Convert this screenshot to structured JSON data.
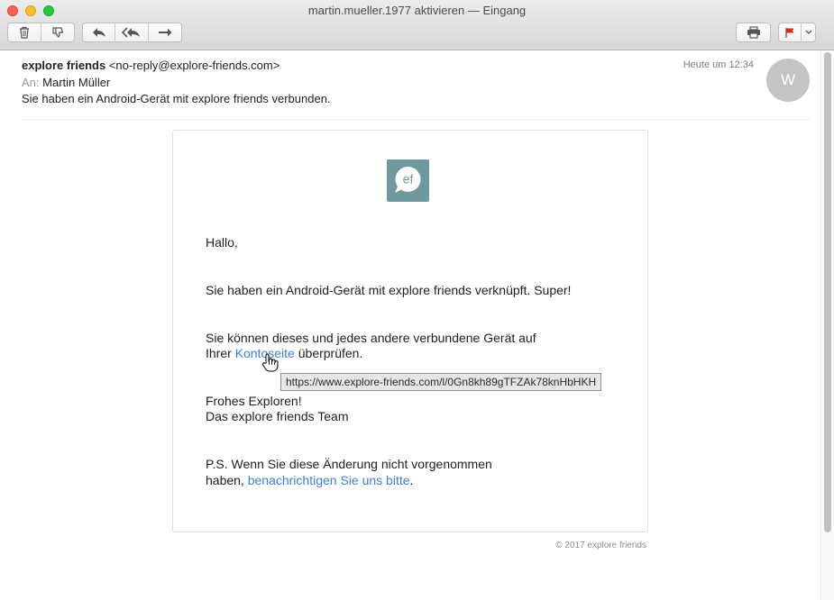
{
  "window": {
    "title": "martin.mueller.1977 aktivieren — Eingang"
  },
  "toolbar": {
    "icons": [
      "trash-icon",
      "junk-thumbs-down-icon",
      "reply-icon",
      "reply-all-icon",
      "forward-icon",
      "print-icon",
      "flag-icon",
      "chevron-down-icon"
    ],
    "flag_color": "#e8271f"
  },
  "email": {
    "from_name": "explore friends",
    "from_address": "<no-reply@explore-friends.com>",
    "to_label": "An:",
    "to_name": "Martin Müller",
    "subject": "Sie haben ein Android-Gerät mit explore friends verbunden.",
    "date": "Heute um 12:34",
    "avatar_initial": "W"
  },
  "message": {
    "logo_text": "ef",
    "greeting": "Hallo,",
    "line1": "Sie haben ein Android-Gerät mit explore friends verknüpft. Super!",
    "line2a": "Sie können dieses und jedes andere verbundene Gerät auf",
    "line2b_pre": "Ihrer ",
    "line2b_link": "Kontoseite",
    "line2b_post": " überprüfen.",
    "closing1": "Frohes Exploren!",
    "closing2": "Das explore friends Team",
    "ps1": "P.S. Wenn Sie diese Änderung nicht vorgenommen",
    "ps2_pre": "haben, ",
    "ps2_link": "benachrichtigen Sie uns bitte",
    "ps2_post": ".",
    "tooltip_url": "https://www.explore-friends.com/l/0Gn8kh89gTFZAk78knHbHKH",
    "footer": "© 2017 explore friends"
  },
  "colors": {
    "logo_bg": "#6e9a9d",
    "link": "#3d7ed8"
  }
}
